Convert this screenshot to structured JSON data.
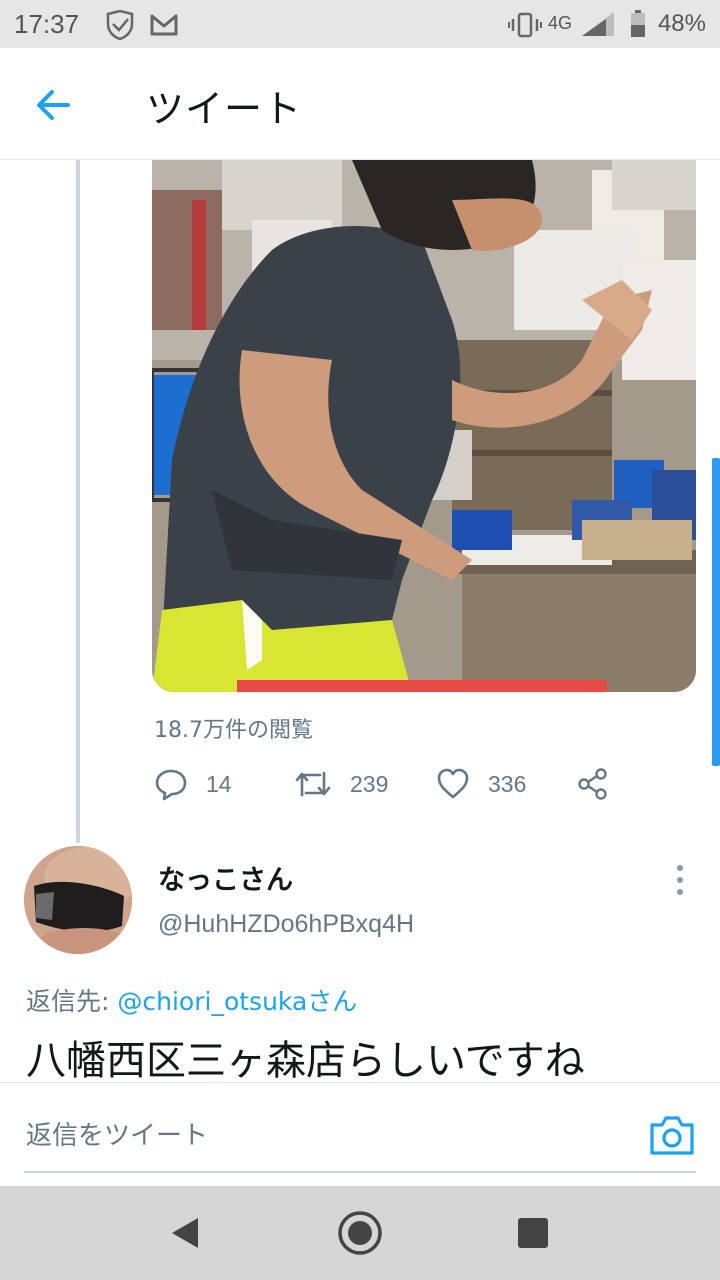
{
  "status_bar": {
    "time": "17:37",
    "network": "4G",
    "battery": "48%"
  },
  "header": {
    "title": "ツイート",
    "back_icon": "arrow-left-icon"
  },
  "tweet": {
    "views": "18.7万件の閲覧",
    "actions": {
      "reply_count": "14",
      "retweet_count": "239",
      "like_count": "336"
    }
  },
  "reply": {
    "name": "なっこさん",
    "handle": "@HuhHZDo6hPBxq4H",
    "reply_to_label": "返信先:",
    "reply_to_mention": "@chiori_otsukaさん",
    "text": "八幡西区三ヶ森店らしいですね"
  },
  "composer": {
    "placeholder": "返信をツイート"
  },
  "colors": {
    "accent": "#1da1f2",
    "muted": "#657786",
    "text": "#14171a"
  }
}
